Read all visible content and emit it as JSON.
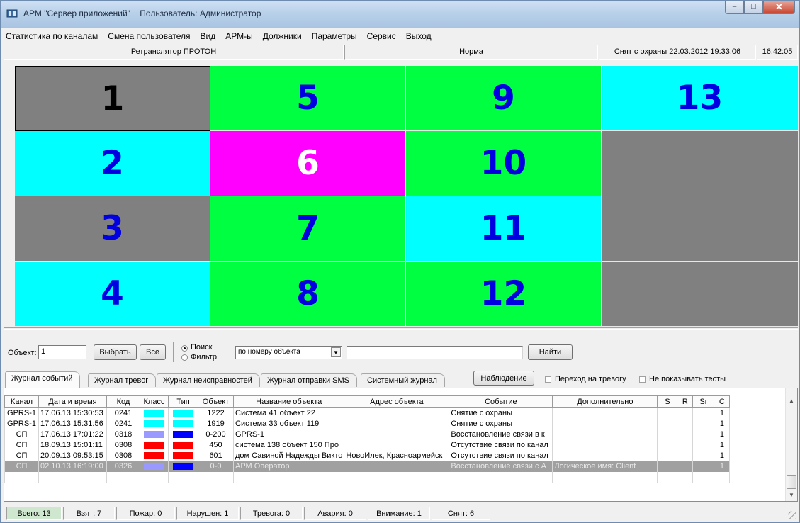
{
  "window": {
    "title": "АРМ \"Сервер приложений\"    Пользователь: Администратор",
    "controls": {
      "minimize": "–",
      "maximize": "□",
      "close": "✕"
    }
  },
  "menu": [
    "Статистика по каналам",
    "Смена пользователя",
    "Вид",
    "АРМ-ы",
    "Должники",
    "Параметры",
    "Сервис",
    "Выход"
  ],
  "status": {
    "device": "Ретранслятор ПРОТОН",
    "state": "Норма",
    "guard": "Снят с охраны 22.03.2012 19:33:06",
    "time": "16:42:05"
  },
  "colors": {
    "gray": "#808080",
    "green": "#00ff40",
    "cyan": "#00ffff",
    "magenta": "#ff00ff",
    "blue_text": "#0000e0",
    "black_text": "#000000",
    "white_text": "#ffffff"
  },
  "grid": {
    "cells": [
      {
        "number": "1",
        "bg": "#808080",
        "fg": "#000000",
        "selected": true
      },
      {
        "number": "5",
        "bg": "#00ff40",
        "fg": "#0000e0"
      },
      {
        "number": "9",
        "bg": "#00ff40",
        "fg": "#0000e0"
      },
      {
        "number": "13",
        "bg": "#00ffff",
        "fg": "#0000e0"
      },
      {
        "number": "2",
        "bg": "#00ffff",
        "fg": "#0000e0"
      },
      {
        "number": "6",
        "bg": "#ff00ff",
        "fg": "#ffffff"
      },
      {
        "number": "10",
        "bg": "#00ff40",
        "fg": "#0000e0"
      },
      {
        "number": "",
        "bg": "#808080",
        "fg": "#0000e0"
      },
      {
        "number": "3",
        "bg": "#808080",
        "fg": "#0000e0"
      },
      {
        "number": "7",
        "bg": "#00ff40",
        "fg": "#0000e0"
      },
      {
        "number": "11",
        "bg": "#00ffff",
        "fg": "#0000e0"
      },
      {
        "number": "",
        "bg": "#808080",
        "fg": "#0000e0"
      },
      {
        "number": "4",
        "bg": "#00ffff",
        "fg": "#0000e0"
      },
      {
        "number": "8",
        "bg": "#00ff40",
        "fg": "#0000e0"
      },
      {
        "number": "12",
        "bg": "#00ff40",
        "fg": "#0000e0"
      },
      {
        "number": "",
        "bg": "#808080",
        "fg": "#0000e0"
      }
    ]
  },
  "search": {
    "object_label": "Объект:",
    "object_value": "1",
    "select_button": "Выбрать",
    "all_button": "Все",
    "radio_search": "Поиск",
    "radio_filter": "Фильтр",
    "mode_selected": "по номеру объекта",
    "query_value": "",
    "find_button": "Найти"
  },
  "tabs": [
    "Журнал событий",
    "Журнал тревог",
    "Журнал неисправностей",
    "Журнал отправки SMS",
    "Системный журнал"
  ],
  "active_tab": 0,
  "observe_button": "Наблюдение",
  "checkbox_alarm": "Переход на тревогу",
  "checkbox_tests": "Не показывать тесты",
  "table": {
    "headers": [
      "Канал",
      "Дата и время",
      "Код",
      "Класс",
      "Тип",
      "Объект",
      "Название объекта",
      "Адрес объекта",
      "Событие",
      "Дополнительно",
      "S",
      "R",
      "Sr",
      "C"
    ],
    "rows": [
      {
        "channel": "GPRS-1",
        "datetime": "17.06.13  15:30:53",
        "code": "0241",
        "class_color": "#00ffff",
        "type_color": "#00ffff",
        "object": "1222",
        "name": "Система 41 объект 22",
        "address": "",
        "event": "Снятие с охраны",
        "extra": "",
        "s": "",
        "r": "",
        "sr": "",
        "c": "1"
      },
      {
        "channel": "GPRS-1",
        "datetime": "17.06.13  15:31:56",
        "code": "0241",
        "class_color": "#00ffff",
        "type_color": "#00ffff",
        "object": "1919",
        "name": "Система 33 объект 119",
        "address": "",
        "event": "Снятие с охраны",
        "extra": "",
        "s": "",
        "r": "",
        "sr": "",
        "c": "1"
      },
      {
        "channel": "СП",
        "datetime": "17.06.13  17:01:22",
        "code": "0318",
        "class_color": "#9999ff",
        "type_color": "#0000ff",
        "object": "0-200",
        "name": "GPRS-1",
        "address": "",
        "event": "Восстановление связи в к",
        "extra": "",
        "s": "",
        "r": "",
        "sr": "",
        "c": "1"
      },
      {
        "channel": "СП",
        "datetime": "18.09.13  15:01:11",
        "code": "0308",
        "class_color": "#ff0000",
        "type_color": "#ff0000",
        "object": "450",
        "name": "система 138 объект 150  Про",
        "address": "",
        "event": "Отсутствие связи по канал",
        "extra": "",
        "s": "",
        "r": "",
        "sr": "",
        "c": "1"
      },
      {
        "channel": "СП",
        "datetime": "20.09.13  09:53:15",
        "code": "0308",
        "class_color": "#ff0000",
        "type_color": "#ff0000",
        "object": "601",
        "name": "дом Савиной Надежды Викто",
        "address": "НовоИлек, Красноармейск",
        "event": "Отсутствие связи по канал",
        "extra": "",
        "s": "",
        "r": "",
        "sr": "",
        "c": "1"
      },
      {
        "channel": "СП",
        "datetime": "02.10.13  16:19:00",
        "code": "0326",
        "class_color": "#9999ff",
        "type_color": "#0000ff",
        "object": "0-0",
        "name": "АРМ Оператор",
        "address": "",
        "event": "Восстановление связи с А",
        "extra": "Логическое имя: Client",
        "s": "",
        "r": "",
        "sr": "",
        "c": "1",
        "selected": true
      }
    ]
  },
  "statusbar": [
    "Всего: 13",
    "Взят: 7",
    "Пожар: 0",
    "Нарушен: 1",
    "Тревога: 0",
    "Авария: 0",
    "Внимание: 1",
    "Снят: 6"
  ]
}
